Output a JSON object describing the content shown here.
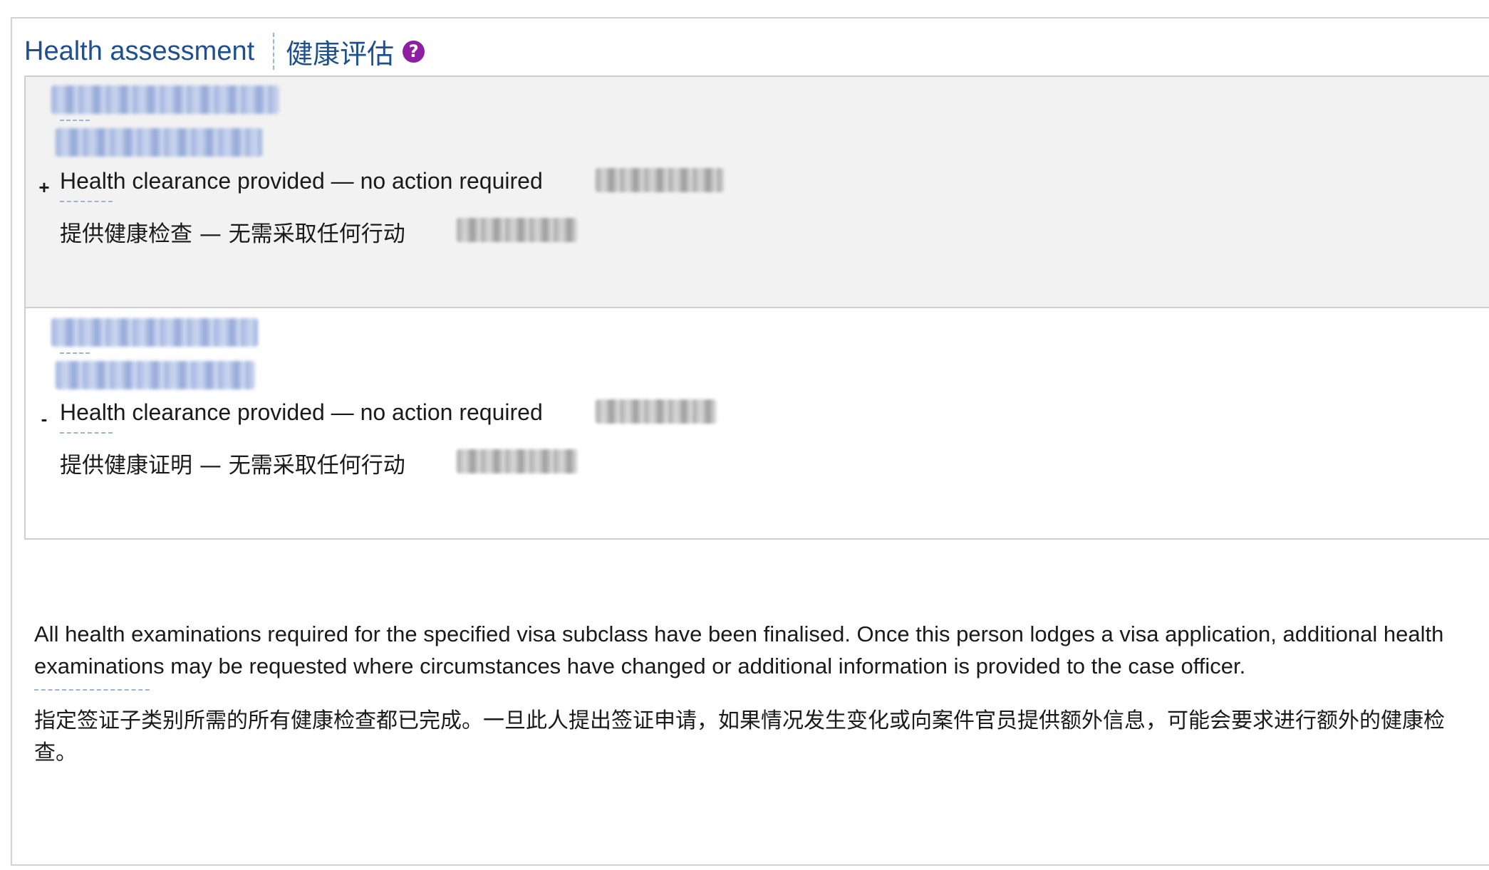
{
  "header": {
    "title_en": "Health assessment",
    "title_zh": "健康评估",
    "help_glyph": "?"
  },
  "records": [
    {
      "state": "expanded",
      "toggle_glyph": "+",
      "status_en": "Health clearance provided — no action required",
      "status_zh": "提供健康检查 — 无需采取任何行动"
    },
    {
      "state": "collapsed",
      "toggle_glyph": "-",
      "status_en": "Health clearance provided — no action required",
      "status_zh": "提供健康证明 — 无需采取任何行动"
    }
  ],
  "notes": {
    "en": "All health examinations required for the specified visa subclass have been finalised. Once this person lodges a visa application, additional health examinations may be requested where circumstances have changed or additional information is provided to the case officer.",
    "zh": "指定签证子类别所需的所有健康检查都已完成。一旦此人提出签证申请，如果情况发生变化或向案件官员提供额外信息，可能会要求进行额外的健康检查。"
  },
  "colors": {
    "title": "#1d4f91",
    "help_icon": "#8e1fa3",
    "row_expanded_bg": "#f2f2f2",
    "border": "#d2d2d2"
  },
  "icons": {
    "help": "help-icon",
    "expand": "expand-icon",
    "collapse": "collapse-icon"
  }
}
